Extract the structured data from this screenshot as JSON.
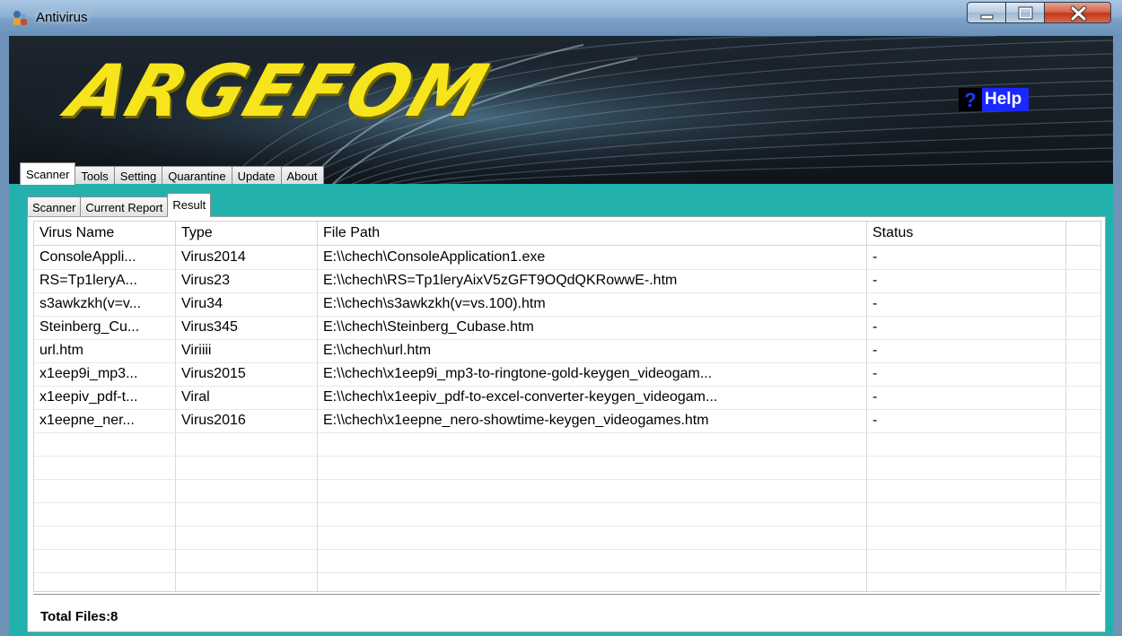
{
  "window": {
    "title": "Antivirus"
  },
  "header": {
    "logo_text": "ARGEFOM",
    "help_label": "Help",
    "help_icon": "question-mark"
  },
  "main_tabs": [
    {
      "label": "Scanner",
      "active": true
    },
    {
      "label": "Tools",
      "active": false
    },
    {
      "label": "Setting",
      "active": false
    },
    {
      "label": "Quarantine",
      "active": false
    },
    {
      "label": "Update",
      "active": false
    },
    {
      "label": "About",
      "active": false
    }
  ],
  "sub_tabs": [
    {
      "label": "Scanner",
      "active": false
    },
    {
      "label": "Current Report",
      "active": false
    },
    {
      "label": "Result",
      "active": true
    }
  ],
  "table": {
    "columns": [
      "Virus Name",
      "Type",
      "File Path",
      "Status"
    ],
    "rows": [
      [
        "ConsoleAppli...",
        "Virus2014",
        "E:\\\\chech\\ConsoleApplication1.exe",
        "-"
      ],
      [
        "RS=Tp1leryA...",
        "Virus23",
        "E:\\\\chech\\RS=Tp1leryAixV5zGFT9OQdQKRowwE-.htm",
        "-"
      ],
      [
        "s3awkzkh(v=v...",
        "Viru34",
        "E:\\\\chech\\s3awkzkh(v=vs.100).htm",
        "-"
      ],
      [
        "Steinberg_Cu...",
        "Virus345",
        "E:\\\\chech\\Steinberg_Cubase.htm",
        "-"
      ],
      [
        "url.htm",
        "Viriiii",
        "E:\\\\chech\\url.htm",
        "-"
      ],
      [
        "x1eep9i_mp3...",
        "Virus2015",
        "E:\\\\chech\\x1eep9i_mp3-to-ringtone-gold-keygen_videogam...",
        "-"
      ],
      [
        "x1eepiv_pdf-t...",
        "Viral",
        "E:\\\\chech\\x1eepiv_pdf-to-excel-converter-keygen_videogam...",
        "-"
      ],
      [
        "x1eepne_ner...",
        "Virus2016",
        "E:\\\\chech\\x1eepne_nero-showtime-keygen_videogames.htm",
        "-"
      ]
    ],
    "empty_rows": 7
  },
  "footer": {
    "total_label": "Total Files:8"
  },
  "colors": {
    "panel": "#22b1ad",
    "logo": "#f6e41c",
    "help_bg": "#1928ff"
  }
}
